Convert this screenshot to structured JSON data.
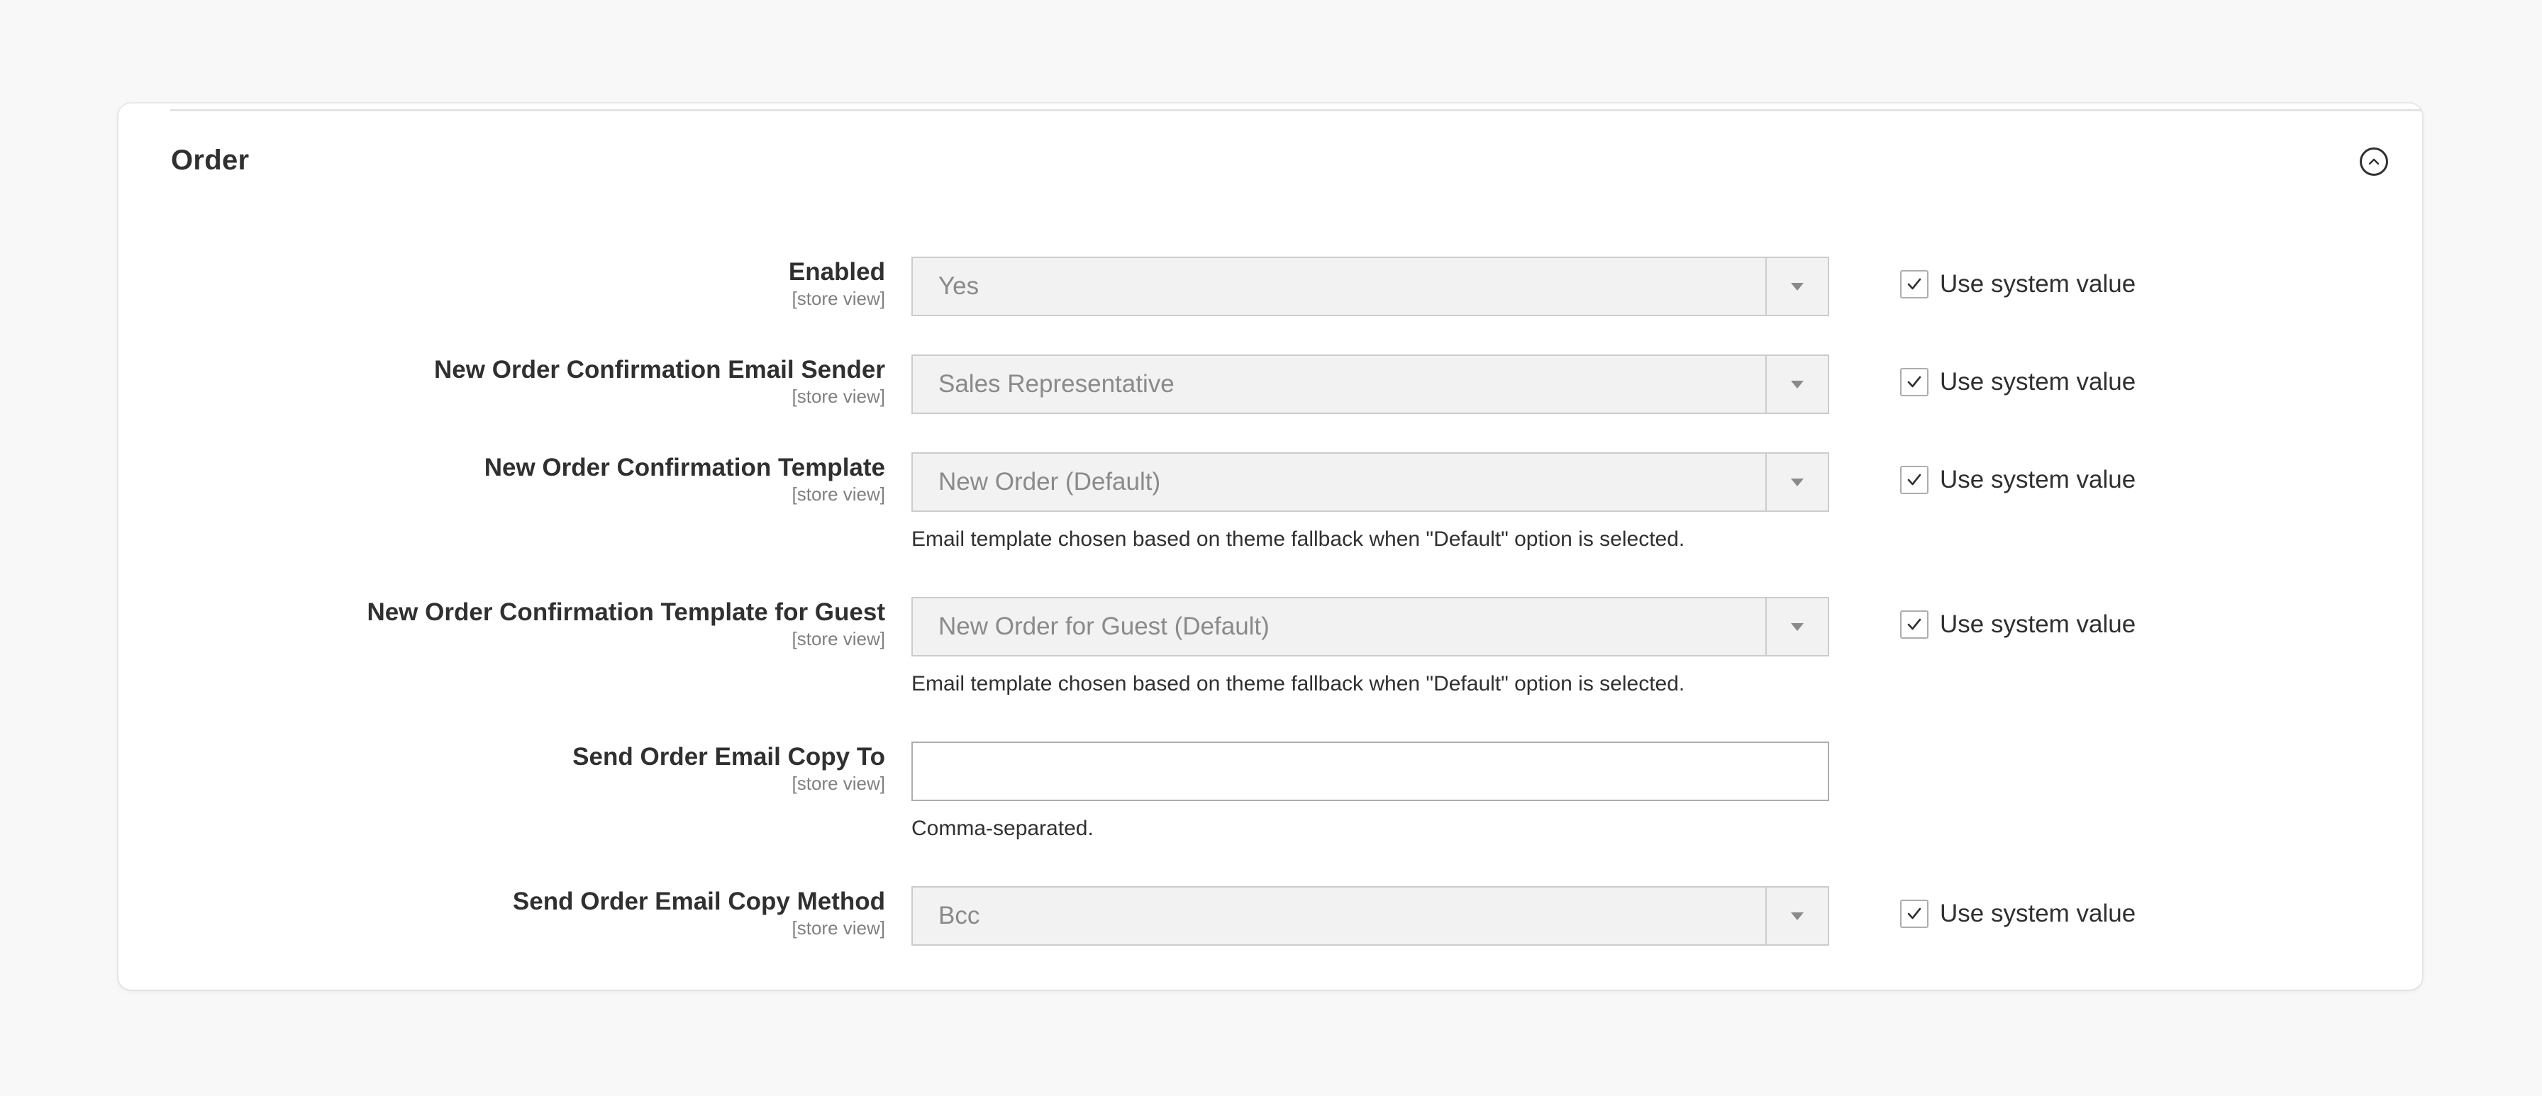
{
  "section": {
    "title": "Order",
    "collapse_icon": "chevron-up-circle-icon"
  },
  "fields": [
    {
      "label": "Enabled",
      "scope": "[store view]",
      "type": "select",
      "value": "Yes",
      "use_system_value": true,
      "system_label": "Use system value"
    },
    {
      "label": "New Order Confirmation Email Sender",
      "scope": "[store view]",
      "type": "select",
      "value": "Sales Representative",
      "use_system_value": true,
      "system_label": "Use system value"
    },
    {
      "label": "New Order Confirmation Template",
      "scope": "[store view]",
      "type": "select",
      "value": "New Order (Default)",
      "note": "Email template chosen based on theme fallback when \"Default\" option is selected.",
      "use_system_value": true,
      "system_label": "Use system value"
    },
    {
      "label": "New Order Confirmation Template for Guest",
      "scope": "[store view]",
      "type": "select",
      "value": "New Order for Guest (Default)",
      "note": "Email template chosen based on theme fallback when \"Default\" option is selected.",
      "use_system_value": true,
      "system_label": "Use system value"
    },
    {
      "label": "Send Order Email Copy To",
      "scope": "[store view]",
      "type": "text",
      "value": "",
      "note": "Comma-separated."
    },
    {
      "label": "Send Order Email Copy Method",
      "scope": "[store view]",
      "type": "select",
      "value": "Bcc",
      "use_system_value": true,
      "system_label": "Use system value"
    }
  ],
  "colors": {
    "disabled_fill": "#f2f2f2",
    "border": "#cccccc",
    "text": "#303030",
    "muted": "#8a8a8a"
  }
}
